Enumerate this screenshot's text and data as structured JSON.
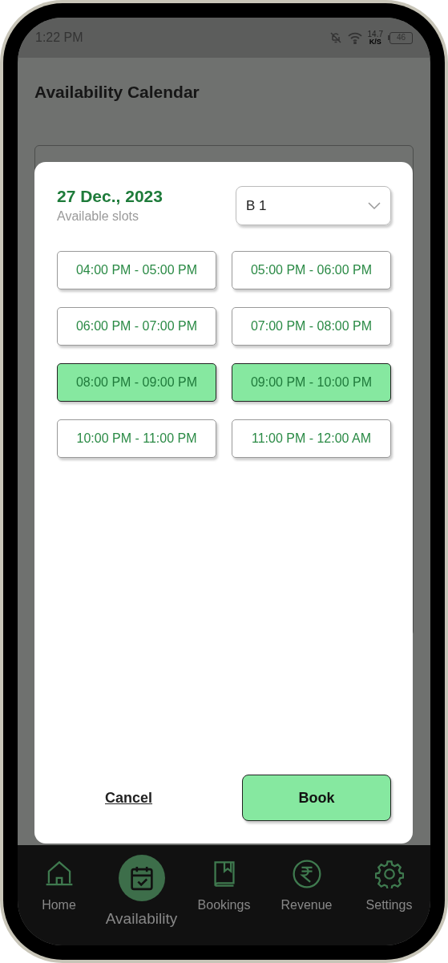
{
  "status_bar": {
    "time": "1:22 PM",
    "speed": "14.7",
    "speed_unit": "K/S",
    "battery": "46"
  },
  "header": {
    "title": "Availability Calendar"
  },
  "modal": {
    "date": "27 Dec., 2023",
    "subtitle": "Available slots",
    "dropdown": {
      "value": "B 1"
    },
    "slots": [
      {
        "label": "04:00 PM - 05:00 PM",
        "selected": false
      },
      {
        "label": "05:00 PM - 06:00 PM",
        "selected": false
      },
      {
        "label": "06:00 PM - 07:00 PM",
        "selected": false
      },
      {
        "label": "07:00 PM - 08:00 PM",
        "selected": false
      },
      {
        "label": "08:00 PM - 09:00 PM",
        "selected": true
      },
      {
        "label": "09:00 PM - 10:00 PM",
        "selected": true
      },
      {
        "label": "10:00 PM - 11:00 PM",
        "selected": false
      },
      {
        "label": "11:00 PM - 12:00 AM",
        "selected": false
      }
    ],
    "cancel": "Cancel",
    "book": "Book"
  },
  "nav": [
    {
      "label": "Home",
      "kind": "home",
      "selected": false
    },
    {
      "label": "Availability",
      "kind": "calendar",
      "selected": true
    },
    {
      "label": "Bookings",
      "kind": "book",
      "selected": false
    },
    {
      "label": "Revenue",
      "kind": "rupee",
      "selected": false
    },
    {
      "label": "Settings",
      "kind": "gear",
      "selected": false
    }
  ]
}
